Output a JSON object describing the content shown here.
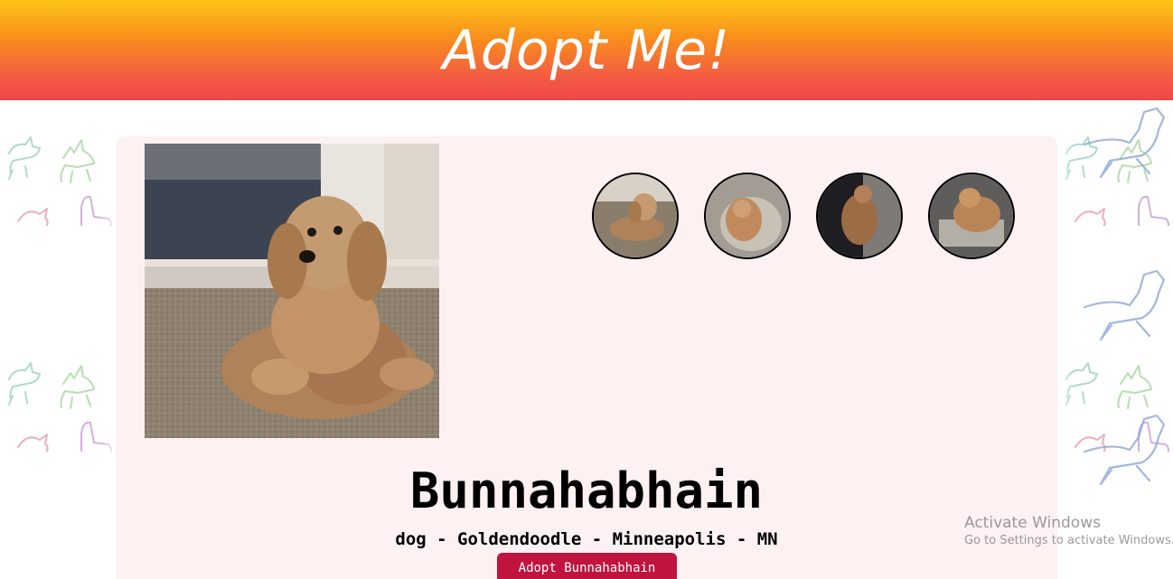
{
  "header": {
    "title": "Adopt Me!"
  },
  "pet": {
    "name": "Bunnahabhain",
    "meta": "dog - Goldendoodle - Minneapolis - MN",
    "adopt_label": "Adopt Bunnahabhain",
    "thumbnail_count": 4
  },
  "watermark": {
    "line1": "Activate Windows",
    "line2": "Go to Settings to activate Windows."
  },
  "colors": {
    "header_gradient": [
      "#fbc617",
      "#f98b1d",
      "#f25746",
      "#ef4748"
    ],
    "card_background": "#fef1f2",
    "button_background": "#c0143e"
  }
}
